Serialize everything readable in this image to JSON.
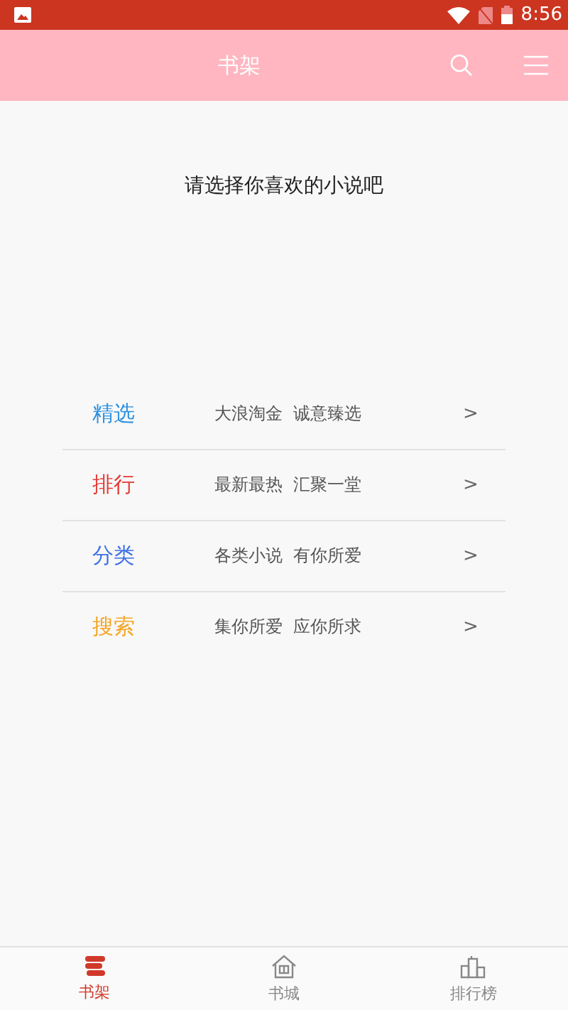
{
  "status_bar": {
    "time": "8:56"
  },
  "header": {
    "title": "书架"
  },
  "prompt": "请选择你喜欢的小说吧",
  "menu": [
    {
      "label": "精选",
      "color": "#2a8fe0",
      "description": "大浪淘金  诚意臻选",
      "chevron": ">"
    },
    {
      "label": "排行",
      "color": "#e53935",
      "description": "最新最热  汇聚一堂",
      "chevron": ">"
    },
    {
      "label": "分类",
      "color": "#3b6fe6",
      "description": "各类小说  有你所爱",
      "chevron": ">"
    },
    {
      "label": "搜索",
      "color": "#f5a623",
      "description": "集你所爱  应你所求",
      "chevron": ">"
    }
  ],
  "tabs": [
    {
      "kind": "shelf",
      "label": "书架",
      "selected": true
    },
    {
      "kind": "store",
      "label": "书城",
      "selected": false
    },
    {
      "kind": "rank",
      "label": "排行榜",
      "selected": false
    }
  ]
}
